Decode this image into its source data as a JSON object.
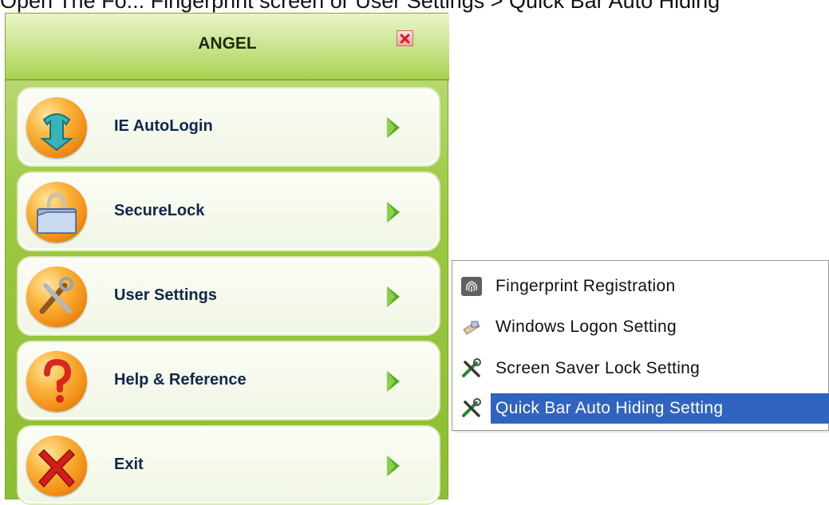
{
  "caption": "Open The Fo... Fingerprint screen or User Settings > Quick Bar Auto Hiding",
  "window": {
    "title": "ANGEL",
    "close_icon": "close-icon"
  },
  "menu": {
    "items": [
      {
        "label": "IE AutoLogin",
        "icon": "download-arrow-icon"
      },
      {
        "label": "SecureLock",
        "icon": "folder-lock-icon"
      },
      {
        "label": "User Settings",
        "icon": "tools-icon"
      },
      {
        "label": "Help & Reference",
        "icon": "question-mark-icon"
      },
      {
        "label": "Exit",
        "icon": "x-exit-icon"
      }
    ],
    "arrow_icon": "chevron-right-icon"
  },
  "submenu": {
    "items": [
      {
        "label": "Fingerprint Registration",
        "icon": "fingerprint-icon",
        "selected": false
      },
      {
        "label": "Windows Logon Setting",
        "icon": "logon-icon",
        "selected": false
      },
      {
        "label": "Screen Saver Lock Setting",
        "icon": "tools-icon",
        "selected": false
      },
      {
        "label": "Quick Bar Auto Hiding Setting",
        "icon": "tools-icon",
        "selected": true
      }
    ]
  },
  "colors": {
    "panel_green": "#9cc843",
    "selection_blue": "#3064c0",
    "label_navy": "#10264a"
  }
}
